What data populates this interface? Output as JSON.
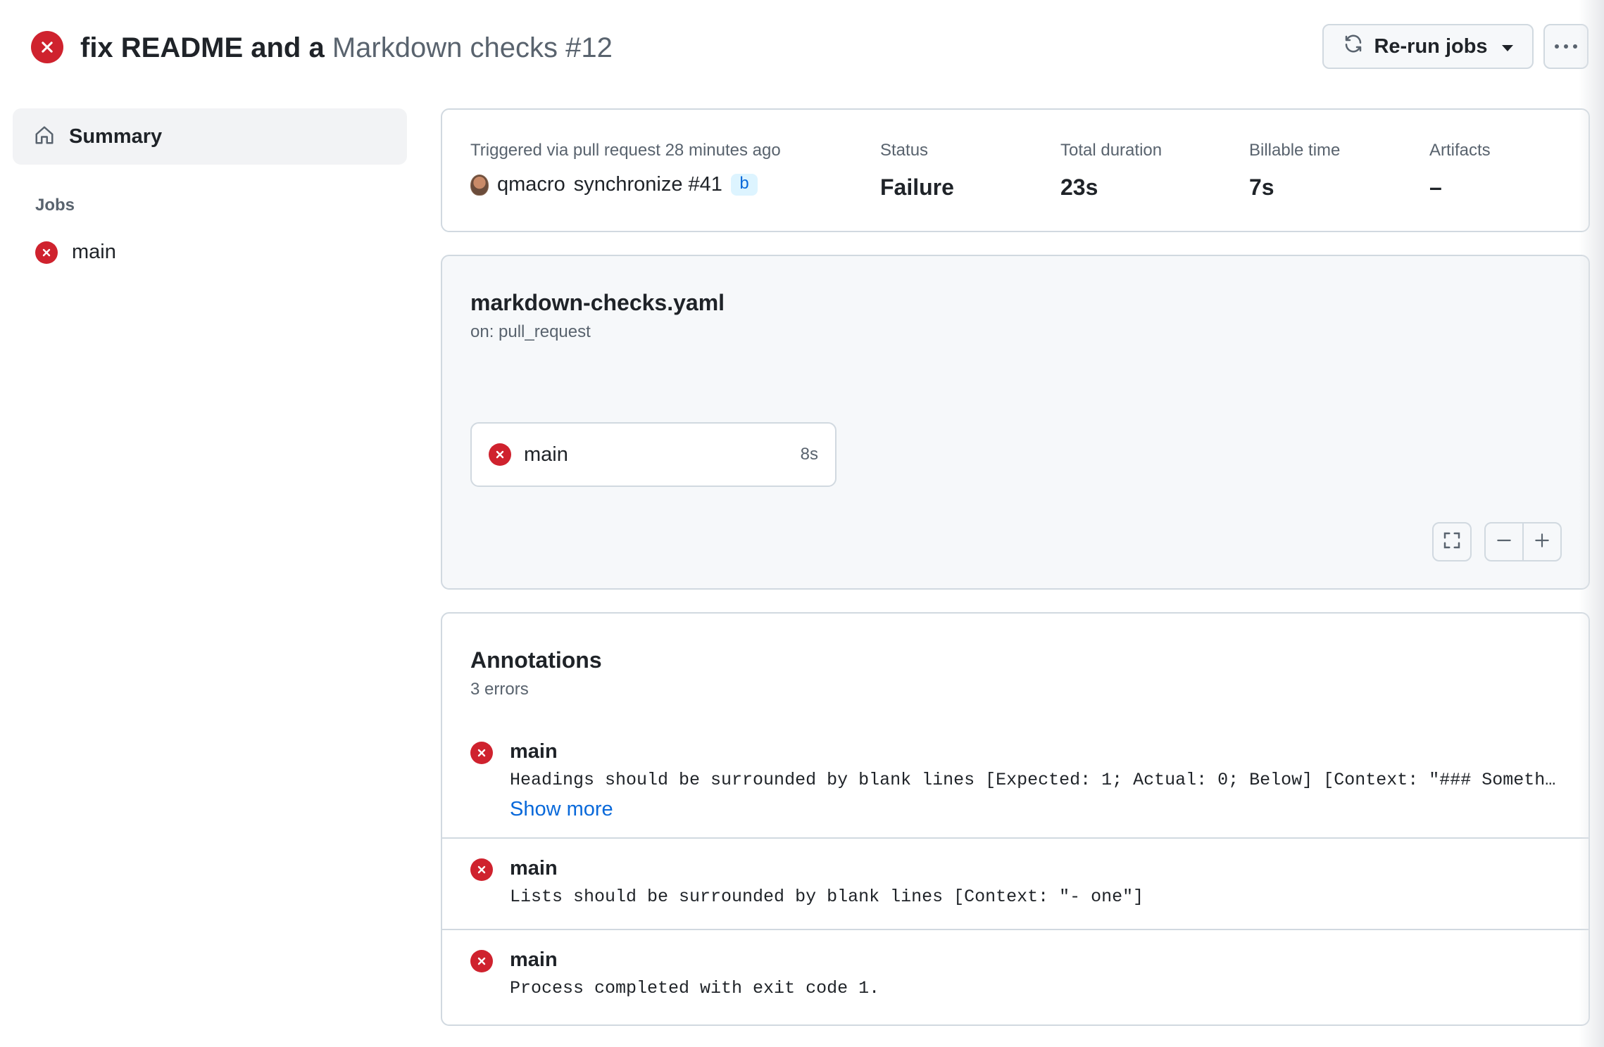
{
  "header": {
    "title_bold": "fix README and a",
    "title_workflow": "Markdown checks #12",
    "rerun_label": "Re-run jobs"
  },
  "sidebar": {
    "summary_label": "Summary",
    "jobs_heading": "Jobs",
    "jobs": [
      {
        "label": "main",
        "status": "failure"
      }
    ]
  },
  "summary": {
    "trigger_text": "Triggered via pull request 28 minutes ago",
    "actor": "qmacro",
    "event": "synchronize #41",
    "branch": "b",
    "status_label": "Status",
    "status_value": "Failure",
    "duration_label": "Total duration",
    "duration_value": "23s",
    "billable_label": "Billable time",
    "billable_value": "7s",
    "artifacts_label": "Artifacts",
    "artifacts_value": "–"
  },
  "workflow": {
    "file": "markdown-checks.yaml",
    "trigger": "on: pull_request",
    "job": {
      "name": "main",
      "duration": "8s",
      "status": "failure"
    }
  },
  "annotations": {
    "title": "Annotations",
    "count": "3 errors",
    "show_more": "Show more",
    "items": [
      {
        "job": "main",
        "message": "Headings should be surrounded by blank lines [Expected: 1; Actual: 0; Below] [Context: \"### Something …"
      },
      {
        "job": "main",
        "message": "Lists should be surrounded by blank lines [Context: \"- one\"]"
      },
      {
        "job": "main",
        "message": "Process completed with exit code 1."
      }
    ]
  },
  "colors": {
    "failure": "#cf222e",
    "link": "#0969da",
    "muted_text": "#59636e",
    "border": "#d1d9e0"
  }
}
